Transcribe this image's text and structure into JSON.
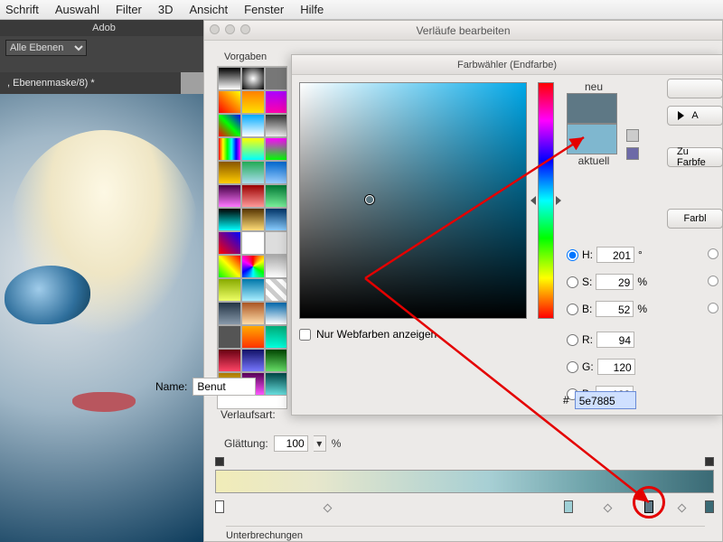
{
  "menu": [
    "Schrift",
    "Auswahl",
    "Filter",
    "3D",
    "Ansicht",
    "Fenster",
    "Hilfe"
  ],
  "ps_app_title": "Adob",
  "layer_dropdown": "Alle Ebenen",
  "doc_tab": ", Ebenenmaske/8) *",
  "gradient_editor": {
    "title": "Verläufe bearbeiten",
    "presets_label": "Vorgaben",
    "name_label": "Name:",
    "name_value": "Benut",
    "type_label": "Verlaufsart:",
    "smoothness_label": "Glättung:",
    "smoothness_value": "100",
    "smoothness_unit": "%",
    "breaks_label": "Unterbrechungen"
  },
  "picker": {
    "title": "Farbwähler (Endfarbe)",
    "new_label": "neu",
    "current_label": "aktuell",
    "ok": " ",
    "cancel": "A",
    "add_lib": "Zu Farbfe",
    "color_libs": "Farbl",
    "webonly": "Nur Webfarben anzeigen",
    "H": {
      "label": "H:",
      "value": "201",
      "unit": "°"
    },
    "S": {
      "label": "S:",
      "value": "29",
      "unit": "%"
    },
    "Bb": {
      "label": "B:",
      "value": "52",
      "unit": "%"
    },
    "R": {
      "label": "R:",
      "value": "94"
    },
    "G": {
      "label": "G:",
      "value": "120"
    },
    "B": {
      "label": "B:",
      "value": "133"
    },
    "hex_label": "#",
    "hex_value": "5e7885",
    "new_color": "#5e7885",
    "current_color": "#7fb7cf"
  },
  "preset_gradients": [
    "linear-gradient(#000,#fff)",
    "radial-gradient(#fff,#000)",
    "linear-gradient(#777,#777)",
    "linear-gradient(45deg,#f00,#ff0)",
    "linear-gradient(#ff8000,#ffe000)",
    "linear-gradient(#a0f,#f0a)",
    "linear-gradient(45deg,#f00,#0f0,#00f)",
    "linear-gradient(#0af,#fff)",
    "linear-gradient(#333,#eee)",
    "linear-gradient(90deg,#f00,#ff0,#0f0,#0ff,#00f,#f0f)",
    "linear-gradient(#ff0,#0ff)",
    "linear-gradient(#f0f,#0f0)",
    "linear-gradient(#850,#fc0)",
    "linear-gradient(#2a5,#ade)",
    "linear-gradient(#06c,#9cf)",
    "linear-gradient(#404,#f7f)",
    "linear-gradient(#900,#f99)",
    "linear-gradient(#073,#7e9)",
    "linear-gradient(#000,#0ff)",
    "linear-gradient(#530,#fd7)",
    "linear-gradient(#036,#8cf)",
    "linear-gradient(45deg,#f00,#00f)",
    "linear-gradient(#fff,#fff)",
    "linear-gradient(#ddd,#ddd)",
    "linear-gradient(45deg,#0f0,#ff0,#f00)",
    "conic-gradient(#f00,#ff0,#0f0,#0ff,#00f,#f0f,#f00)",
    "linear-gradient(#aaa,#fff)",
    "linear-gradient(#8a0,#ef6)",
    "linear-gradient(#07a,#aef)",
    "repeating-linear-gradient(45deg,#ccc 0 5px,#fff 5px 10px)",
    "linear-gradient(#234,#89a)",
    "linear-gradient(#a52,#fda)",
    "linear-gradient(#06a,#fff)",
    "linear-gradient(#555,#555)",
    "linear-gradient(#fa0,#f30)",
    "linear-gradient(#0a7,#0fd)",
    "linear-gradient(#601,#f46)",
    "linear-gradient(#116,#77f)",
    "linear-gradient(#040,#6d6)",
    "linear-gradient(#a70,#fe6)",
    "linear-gradient(#505,#f5f)",
    "linear-gradient(#044,#6dd)"
  ]
}
